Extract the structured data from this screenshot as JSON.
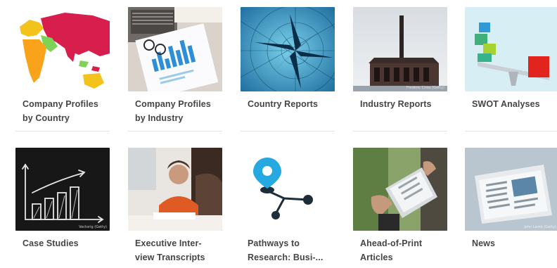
{
  "tiles": [
    {
      "label_line1": "Company Profiles",
      "label_line2": "by Country",
      "icon": "world-map-icon",
      "credit": ""
    },
    {
      "label_line1": "Company Profiles",
      "label_line2": "by Industry",
      "icon": "industry-charts-icon",
      "credit": ""
    },
    {
      "label_line1": "Country Reports",
      "label_line2": "",
      "icon": "compass-rose-icon",
      "credit": ""
    },
    {
      "label_line1": "Industry Reports",
      "label_line2": "",
      "icon": "factory-icon",
      "credit": "Frederic Cirou (Getty)"
    },
    {
      "label_line1": "SWOT Analyses",
      "label_line2": "",
      "icon": "balance-scale-icon",
      "credit": ""
    },
    {
      "label_line1": "Case Studies",
      "label_line2": "",
      "icon": "chalkboard-chart-icon",
      "credit": "Vectorig (Getty)"
    },
    {
      "label_line1": "Executive Inter-",
      "label_line2": "view Transcripts",
      "icon": "executive-photo-icon",
      "credit": ""
    },
    {
      "label_line1": "Pathways to",
      "label_line2": "Research: Busi-...",
      "icon": "location-path-icon",
      "credit": ""
    },
    {
      "label_line1": "Ahead-of-Print",
      "label_line2": "Articles",
      "icon": "tablet-reading-icon",
      "credit": ""
    },
    {
      "label_line1": "News",
      "label_line2": "",
      "icon": "newspapers-icon",
      "credit": "John Lamb (Getty)"
    }
  ],
  "colors": {
    "label_text": "#454545",
    "rule": "#e4e4e4"
  }
}
